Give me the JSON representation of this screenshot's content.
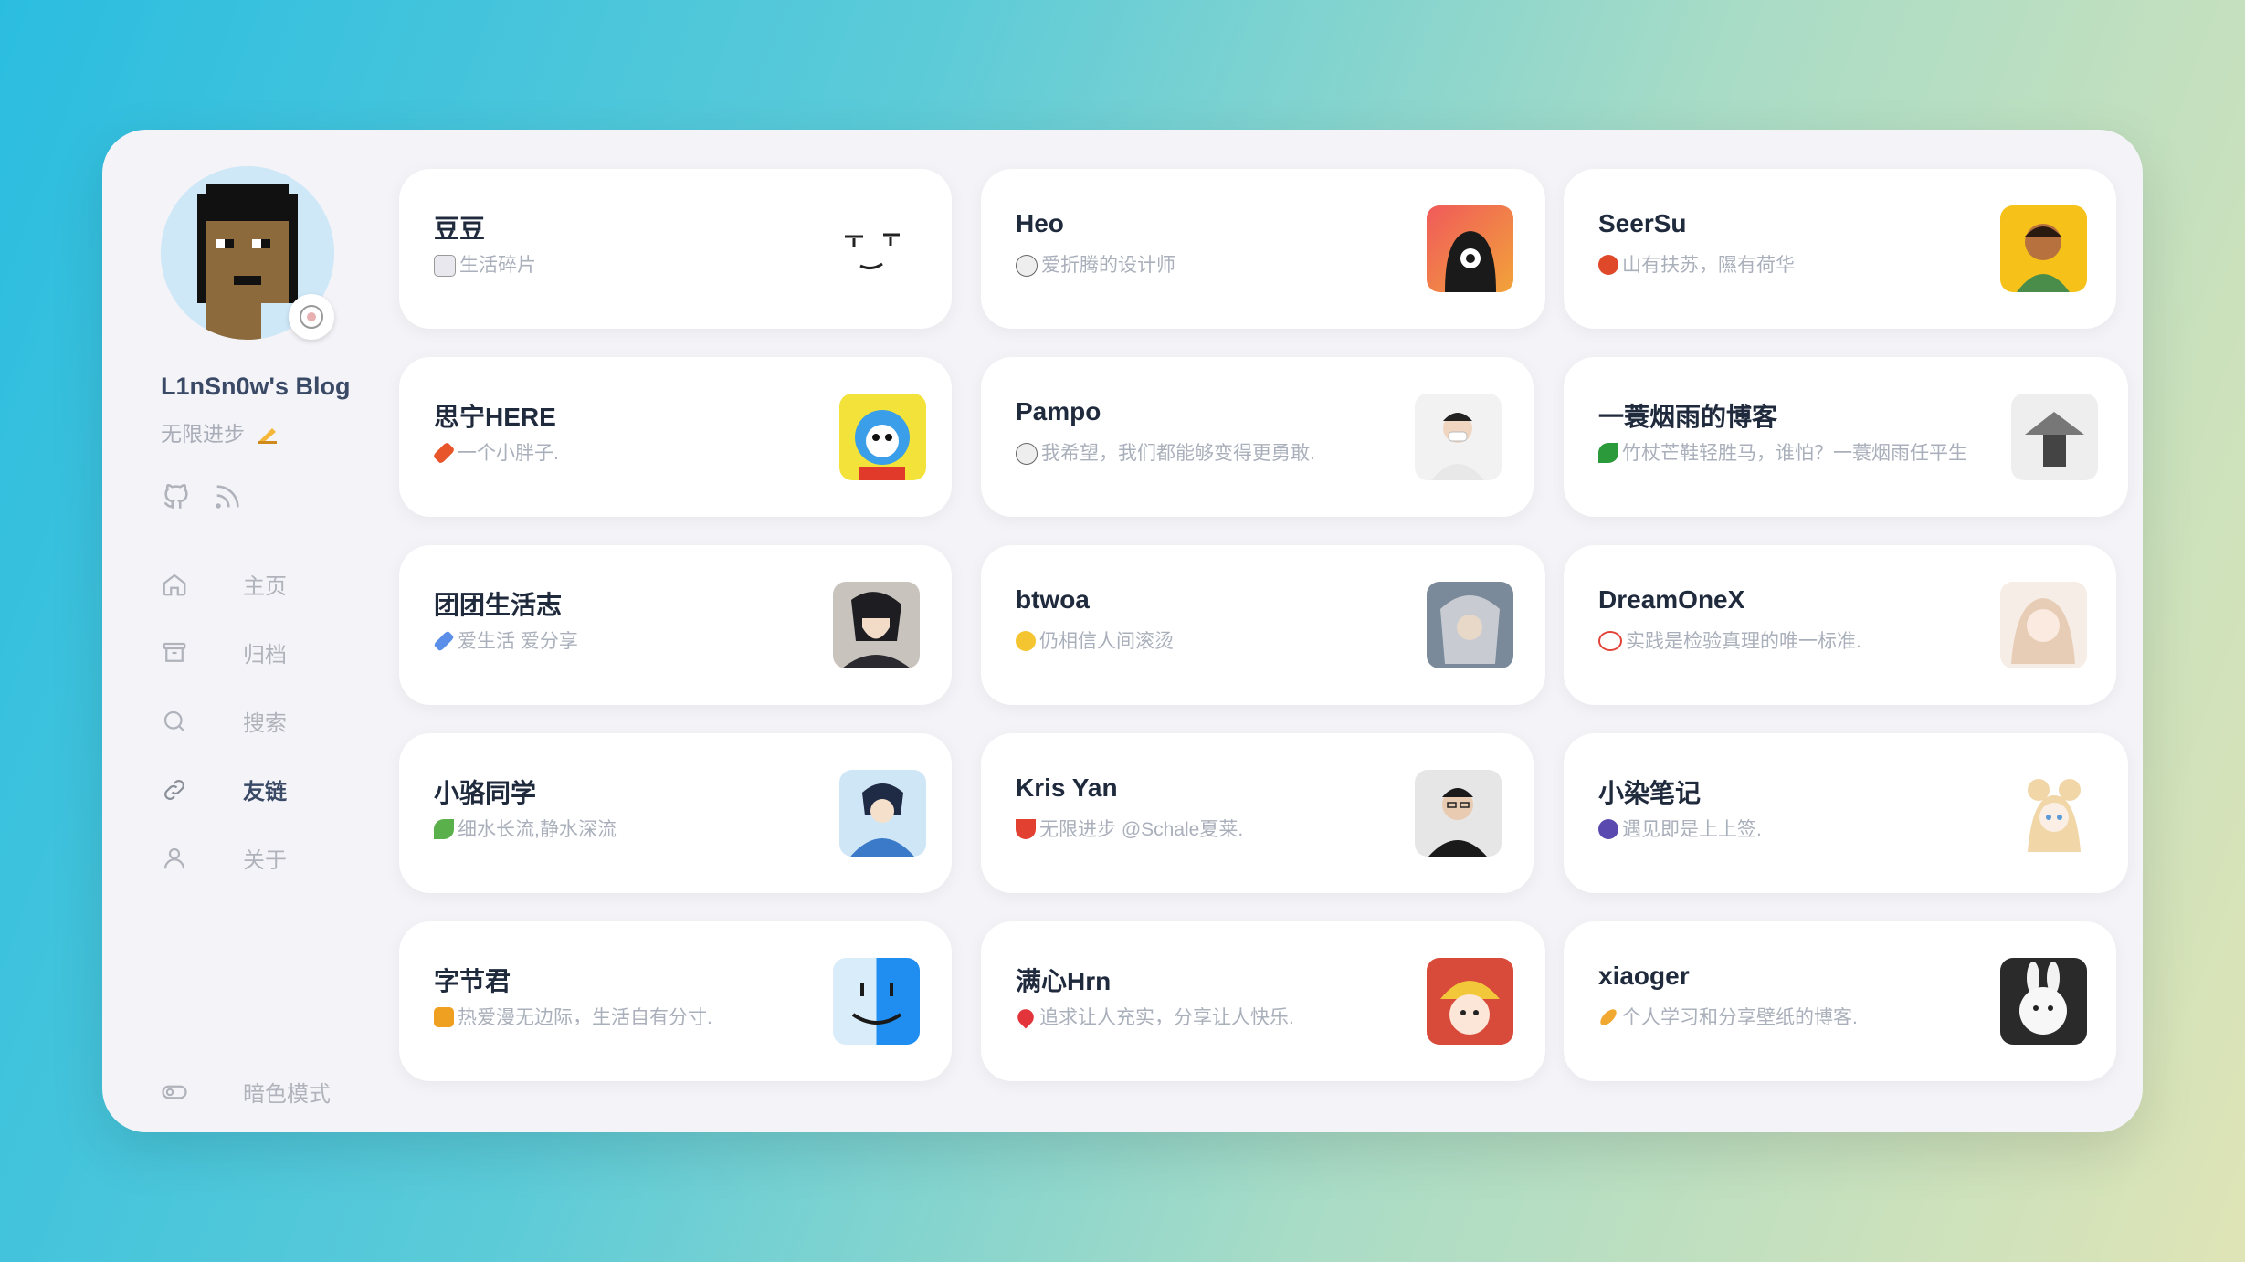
{
  "sidebar": {
    "blog_title": "L1nSn0w's Blog",
    "subtitle": "无限进步",
    "subtitle_icon": "writing-hand-emoji",
    "social": [
      "github-icon",
      "rss-icon"
    ],
    "nav": [
      {
        "label": "主页",
        "icon": "home-icon"
      },
      {
        "label": "归档",
        "icon": "archive-icon"
      },
      {
        "label": "搜索",
        "icon": "search-icon"
      },
      {
        "label": "友链",
        "icon": "link-icon",
        "active": true
      },
      {
        "label": "关于",
        "icon": "user-icon"
      }
    ],
    "dark_mode_label": "暗色模式"
  },
  "colors": {
    "active_text": "#3a4a66",
    "muted_text": "#b0b3bb",
    "card_bg": "#ffffff",
    "panel_bg": "#f4f4f8"
  },
  "friends": [
    {
      "name": "豆豆",
      "desc": "生活碎片",
      "emoji": "phone-emoji",
      "avatar": "face-doodle-avatar"
    },
    {
      "name": "Heo",
      "desc": "爱折腾的设计师",
      "emoji": "rocket-emoji",
      "avatar": "red-one-eye-avatar"
    },
    {
      "name": "SeerSu",
      "desc": "山有扶苏，隰有荷华",
      "emoji": "tomato-emoji",
      "avatar": "cartoon-man-avatar"
    },
    {
      "name": "思宁HERE",
      "desc": "一个小胖子.",
      "emoji": "carrot-emoji",
      "avatar": "blue-bear-avatar"
    },
    {
      "name": "Pampo",
      "desc": "我希望，我们都能够变得更勇敢.",
      "emoji": "rocket-emoji",
      "avatar": "masked-person-avatar"
    },
    {
      "name": "一蓑烟雨的博客",
      "desc": "竹杖芒鞋轻胜马，谁怕？一蓑烟雨任平生",
      "emoji": "leaf-emoji",
      "avatar": "straw-hat-avatar"
    },
    {
      "name": "团团生活志",
      "desc": "爱生活 爱分享",
      "emoji": "rocket-emoji",
      "avatar": "anime-boy-avatar"
    },
    {
      "name": "btwoa",
      "desc": "仍相信人间滚烫",
      "emoji": "smile-emoji",
      "avatar": "white-hair-avatar"
    },
    {
      "name": "DreamOneX",
      "desc": "实践是检验真理的唯一标准.",
      "emoji": "no-entry-emoji",
      "avatar": "anime-girl-avatar"
    },
    {
      "name": "小骆同学",
      "desc": "细水长流,静水深流",
      "emoji": "leaf-emoji",
      "avatar": "anime-blue-boy-avatar"
    },
    {
      "name": "Kris Yan",
      "desc": "无限进步 @Schale夏莱.",
      "emoji": "bowl-emoji",
      "avatar": "man-glasses-avatar"
    },
    {
      "name": "小染笔记",
      "desc": "遇见即是上上签.",
      "emoji": "flower-emoji",
      "avatar": "anime-bun-girl-avatar"
    },
    {
      "name": "字节君",
      "desc": "热爱漫无边际，生活自有分寸.",
      "emoji": "gift-emoji",
      "avatar": "finder-avatar"
    },
    {
      "name": "满心Hrn",
      "desc": "追求让人充实，分享让人快乐.",
      "emoji": "heart-emoji",
      "avatar": "cute-hat-avatar"
    },
    {
      "name": "xiaoger",
      "desc": "个人学习和分享壁纸的博客.",
      "emoji": "pill-emoji",
      "avatar": "white-rabbit-avatar"
    }
  ]
}
